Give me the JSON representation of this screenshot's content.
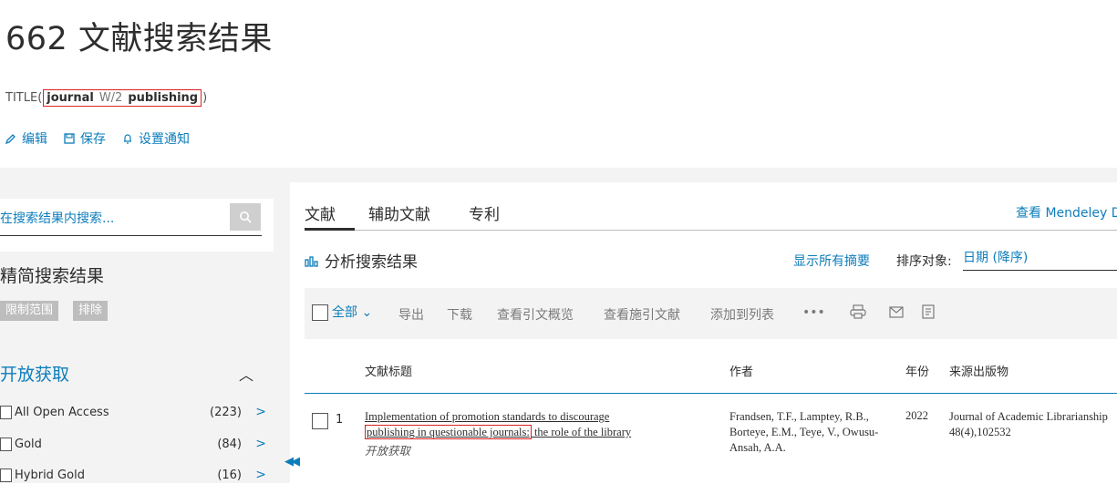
{
  "header": {
    "result_title": "662 文献搜索结果",
    "query": {
      "field": "TITLE",
      "open": "(",
      "term1": "journal",
      "operator": "W/2",
      "term2": "publishing",
      "close": ")"
    },
    "actions": [
      {
        "icon": "pencil-icon",
        "label": "编辑"
      },
      {
        "icon": "save-icon",
        "label": "保存"
      },
      {
        "icon": "bell-icon",
        "label": "设置通知"
      }
    ]
  },
  "sidebar": {
    "search_placeholder": "在搜索结果内搜索...",
    "refine_title": "精简搜索结果",
    "limit_label": "限制范围",
    "exclude_label": "排除",
    "open_access": {
      "title": "开放获取",
      "items": [
        {
          "label": "All Open Access",
          "count": "(223)"
        },
        {
          "label": "Gold",
          "count": "(84)"
        },
        {
          "label": "Hybrid Gold",
          "count": "(16)"
        }
      ]
    }
  },
  "tabs": {
    "documents": "文献",
    "secondary": "辅助文献",
    "patents": "专利"
  },
  "mendeley": "查看 Mendeley D",
  "analyze_label": "分析搜索结果",
  "show_abstracts": "显示所有摘要",
  "sort": {
    "label": "排序对象:",
    "value": "日期 (降序)"
  },
  "toolbar": {
    "all": "全部",
    "export": "导出",
    "download": "下载",
    "citation_overview": "查看引文概览",
    "cited_by": "查看施引文献",
    "add_to_list": "添加到列表",
    "more": "•••"
  },
  "table": {
    "headers": {
      "title": "文献标题",
      "authors": "作者",
      "year": "年份",
      "source": "来源出版物"
    },
    "rows": [
      {
        "num": "1",
        "title_before": "Implementation of promotion standards to discourage",
        "title_marked": "publishing in questionable journals:",
        "title_after": " the role of the library",
        "oa": "开放获取",
        "authors": "Frandsen, T.F., Lamptey, R.B., Borteye, E.M., Teye, V., Owusu-Ansah, A.A.",
        "year": "2022",
        "source_name": "Journal of Academic Librarianship",
        "source_detail": "48(4),102532"
      }
    ]
  },
  "colors": {
    "accent": "#0c7dbb",
    "highlight_box": "#e02020",
    "panel_bg": "#f3f3f3"
  }
}
